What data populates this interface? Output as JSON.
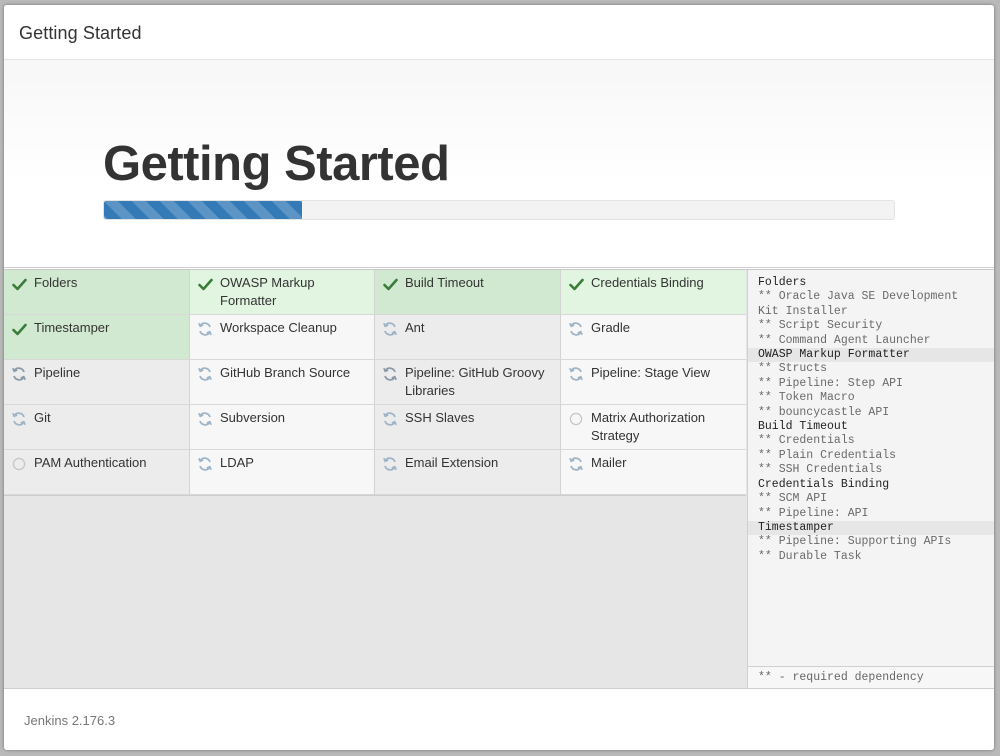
{
  "dialog": {
    "title": "Getting Started"
  },
  "hero": {
    "heading": "Getting Started",
    "progress": 0.25
  },
  "plugins": [
    {
      "name": "Folders",
      "status": "success",
      "shade": "dark"
    },
    {
      "name": "OWASP Markup Formatter",
      "status": "success",
      "shade": "light"
    },
    {
      "name": "Build Timeout",
      "status": "success",
      "shade": "dark"
    },
    {
      "name": "Credentials Binding",
      "status": "success",
      "shade": "light"
    },
    {
      "name": "Timestamper",
      "status": "success",
      "shade": "dark"
    },
    {
      "name": "Workspace Cleanup",
      "status": "pending",
      "shade": "light"
    },
    {
      "name": "Ant",
      "status": "pending",
      "shade": "dark"
    },
    {
      "name": "Gradle",
      "status": "pending",
      "shade": "light"
    },
    {
      "name": "Pipeline",
      "status": "installing",
      "shade": "dark"
    },
    {
      "name": "GitHub Branch Source",
      "status": "pending",
      "shade": "light"
    },
    {
      "name": "Pipeline: GitHub Groovy Libraries",
      "status": "installing",
      "shade": "dark"
    },
    {
      "name": "Pipeline: Stage View",
      "status": "pending",
      "shade": "light"
    },
    {
      "name": "Git",
      "status": "pending",
      "shade": "dark"
    },
    {
      "name": "Subversion",
      "status": "pending",
      "shade": "light"
    },
    {
      "name": "SSH Slaves",
      "status": "pending",
      "shade": "dark"
    },
    {
      "name": "Matrix Authorization Strategy",
      "status": "not-started",
      "shade": "light"
    },
    {
      "name": "PAM Authentication",
      "status": "not-started",
      "shade": "dark"
    },
    {
      "name": "LDAP",
      "status": "pending",
      "shade": "light"
    },
    {
      "name": "Email Extension",
      "status": "pending",
      "shade": "dark"
    },
    {
      "name": "Mailer",
      "status": "pending",
      "shade": "light"
    }
  ],
  "install_log": [
    {
      "text": "Folders",
      "kind": "plugin",
      "shaded": false
    },
    {
      "text": "** Oracle Java SE Development",
      "kind": "dep"
    },
    {
      "text": "Kit Installer",
      "kind": "dep"
    },
    {
      "text": "** Script Security",
      "kind": "dep"
    },
    {
      "text": "** Command Agent Launcher",
      "kind": "dep"
    },
    {
      "text": "OWASP Markup Formatter",
      "kind": "plugin",
      "shaded": true
    },
    {
      "text": "** Structs",
      "kind": "dep"
    },
    {
      "text": "** Pipeline: Step API",
      "kind": "dep"
    },
    {
      "text": "** Token Macro",
      "kind": "dep"
    },
    {
      "text": "** bouncycastle API",
      "kind": "dep"
    },
    {
      "text": "Build Timeout",
      "kind": "plugin",
      "shaded": false
    },
    {
      "text": "** Credentials",
      "kind": "dep"
    },
    {
      "text": "** Plain Credentials",
      "kind": "dep"
    },
    {
      "text": "** SSH Credentials",
      "kind": "dep"
    },
    {
      "text": "Credentials Binding",
      "kind": "plugin",
      "shaded": false
    },
    {
      "text": "** SCM API",
      "kind": "dep"
    },
    {
      "text": "** Pipeline: API",
      "kind": "dep"
    },
    {
      "text": "Timestamper",
      "kind": "plugin",
      "shaded": true
    },
    {
      "text": "** Pipeline: Supporting APIs",
      "kind": "dep"
    },
    {
      "text": "** Durable Task",
      "kind": "dep"
    }
  ],
  "log_footer": "** - required dependency",
  "footer": {
    "version": "Jenkins 2.176.3"
  },
  "colors": {
    "success_icon": "#3a7d3a",
    "pending_icon": "#9fb4c7",
    "installing_icon": "#8a9aa8",
    "progress": "#337ab7"
  },
  "icons": {
    "success": "checkmark-icon",
    "pending": "refresh-icon",
    "installing": "refresh-icon",
    "not-started": "circle-icon"
  }
}
